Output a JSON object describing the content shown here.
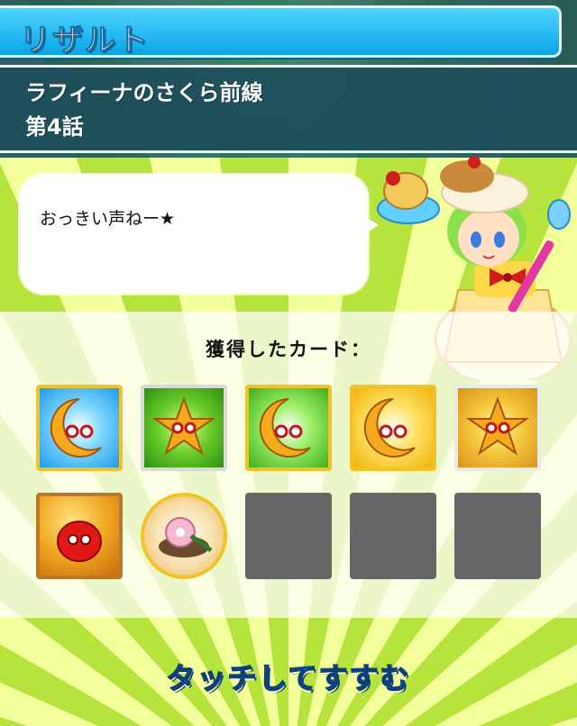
{
  "header": {
    "title": "リザルト"
  },
  "stage": {
    "name": "ラフィーナのさくら前線",
    "episode": "第4話"
  },
  "dialogue": {
    "text": "おっきい声ねー★"
  },
  "cards": {
    "heading": "獲得したカード：",
    "slots": [
      {
        "kind": "puyo-card",
        "color": "blue",
        "icon": "moon-puyo-icon"
      },
      {
        "kind": "puyo-card",
        "color": "green",
        "icon": "star-puyo-icon"
      },
      {
        "kind": "puyo-card",
        "color": "green",
        "icon": "moon-puyo-icon"
      },
      {
        "kind": "puyo-card",
        "color": "yellow",
        "icon": "moon-puyo-icon"
      },
      {
        "kind": "puyo-card",
        "color": "gold",
        "icon": "star-puyo-icon"
      },
      {
        "kind": "puyo-card",
        "color": "orange",
        "icon": "red-puyo-icon"
      },
      {
        "kind": "item-card",
        "color": "cream",
        "icon": "sakura-mochi-icon"
      },
      {
        "kind": "empty"
      },
      {
        "kind": "empty"
      },
      {
        "kind": "empty"
      }
    ]
  },
  "footer": {
    "continue_label": "タッチしてすすむ"
  },
  "colors": {
    "title_bar": "#0aa4e6",
    "empty_slot": "#666666",
    "continue_text": "#1aa9ff"
  }
}
